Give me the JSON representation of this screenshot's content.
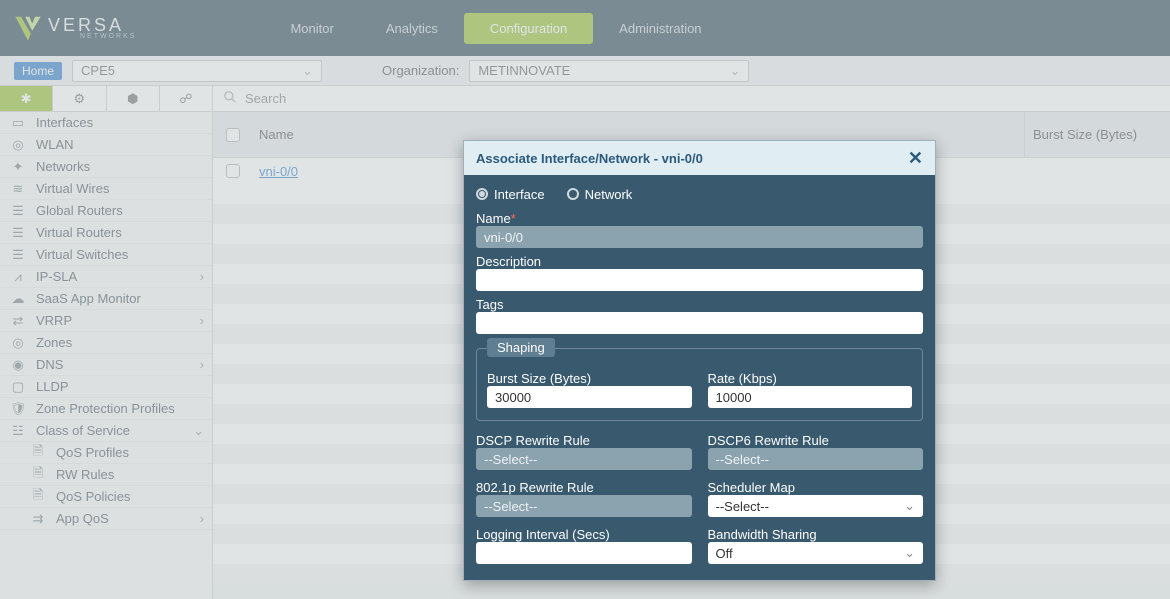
{
  "brand": {
    "name": "VERSA",
    "sub": "NETWORKS"
  },
  "nav": {
    "monitor": "Monitor",
    "analytics": "Analytics",
    "configuration": "Configuration",
    "administration": "Administration"
  },
  "subbar": {
    "home": "Home",
    "device": "CPE5",
    "org_label": "Organization:",
    "org": "METINNOVATE"
  },
  "search": {
    "placeholder": "Search"
  },
  "sidebar": {
    "items": [
      {
        "label": "Interfaces"
      },
      {
        "label": "WLAN"
      },
      {
        "label": "Networks"
      },
      {
        "label": "Virtual Wires"
      },
      {
        "label": "Global Routers"
      },
      {
        "label": "Virtual Routers"
      },
      {
        "label": "Virtual Switches"
      },
      {
        "label": "IP-SLA"
      },
      {
        "label": "SaaS App Monitor"
      },
      {
        "label": "VRRP"
      },
      {
        "label": "Zones"
      },
      {
        "label": "DNS"
      },
      {
        "label": "LLDP"
      },
      {
        "label": "Zone Protection Profiles"
      },
      {
        "label": "Class of Service"
      },
      {
        "label": "QoS Profiles"
      },
      {
        "label": "RW Rules"
      },
      {
        "label": "QoS Policies"
      },
      {
        "label": "App QoS"
      }
    ]
  },
  "table": {
    "col_name": "Name",
    "col_burst": "Burst Size (Bytes)",
    "row0": "vni-0/0"
  },
  "modal": {
    "title": "Associate Interface/Network - vni-0/0",
    "radio_interface": "Interface",
    "radio_network": "Network",
    "name_label": "Name",
    "name_value": "vni-0/0",
    "desc_label": "Description",
    "tags_label": "Tags",
    "shaping_legend": "Shaping",
    "burst_label": "Burst Size (Bytes)",
    "burst_value": "30000",
    "rate_label": "Rate (Kbps)",
    "rate_value": "10000",
    "dscp_label": "DSCP Rewrite Rule",
    "dscp_value": "--Select--",
    "dscp6_label": "DSCP6 Rewrite Rule",
    "dscp6_value": "--Select--",
    "p8021_label": "802.1p Rewrite Rule",
    "p8021_value": "--Select--",
    "sched_label": "Scheduler Map",
    "sched_value": "--Select--",
    "log_label": "Logging Interval (Secs)",
    "bw_label": "Bandwidth Sharing",
    "bw_value": "Off"
  }
}
